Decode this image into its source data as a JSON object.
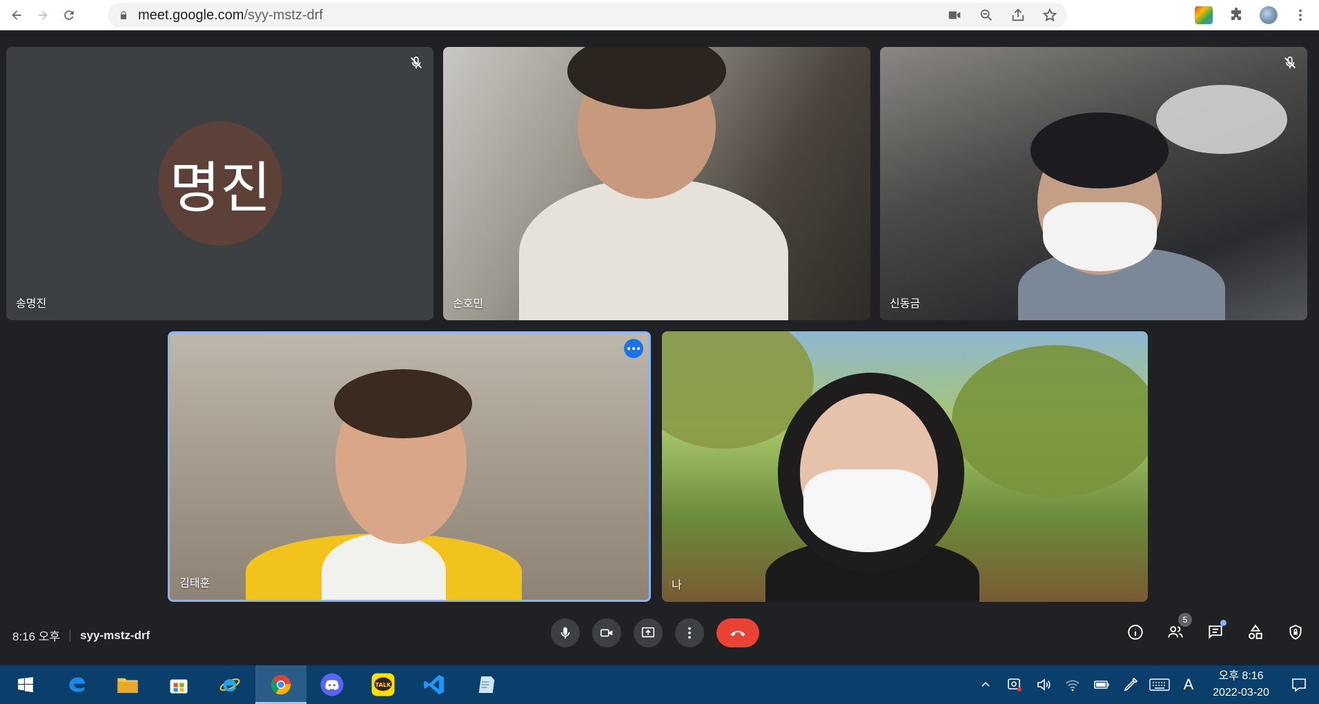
{
  "browser": {
    "url_host": "meet.google.com",
    "url_path": "/syy-mstz-drf"
  },
  "participants": [
    {
      "name": "송명진",
      "avatar_text": "명진",
      "muted": true,
      "camera_on": false
    },
    {
      "name": "손호민",
      "muted": false,
      "camera_on": true
    },
    {
      "name": "신동금",
      "muted": true,
      "camera_on": true
    },
    {
      "name": "김태훈",
      "muted": false,
      "camera_on": true,
      "speaking_highlight": true
    },
    {
      "name": "나",
      "muted": false,
      "camera_on": true
    }
  ],
  "meeting": {
    "time": "8:16 오후",
    "code": "syy-mstz-drf",
    "people_count": "5"
  },
  "taskbar": {
    "clock_time": "오후 8:16",
    "clock_date": "2022-03-20",
    "ime_label": "A"
  },
  "colors": {
    "stage_bg": "#202124",
    "hangup": "#ea4335",
    "highlight": "#8ab4f8",
    "avatar_bg": "#5d4037"
  }
}
